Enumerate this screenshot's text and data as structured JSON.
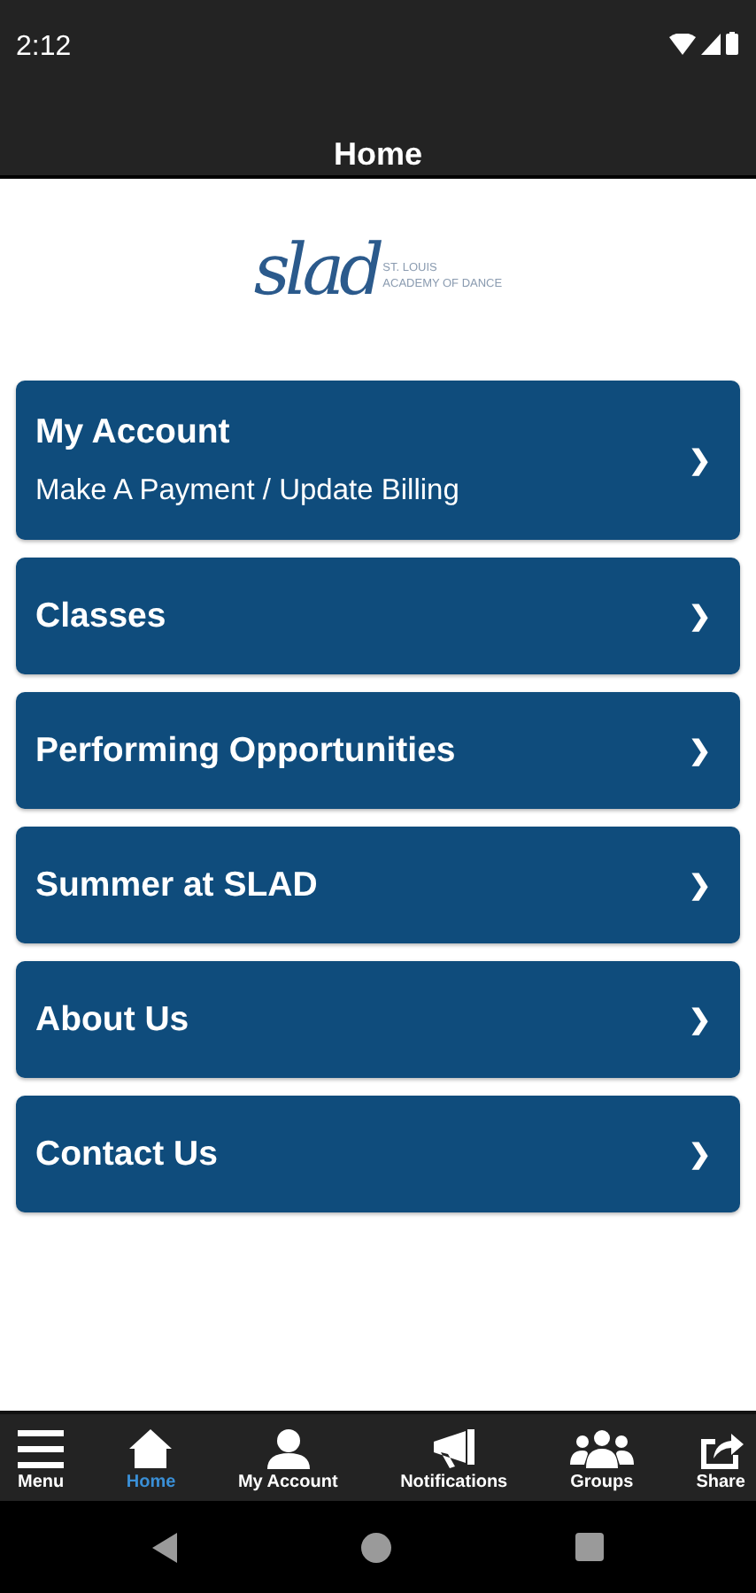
{
  "status_bar": {
    "time": "2:12"
  },
  "header": {
    "title": "Home"
  },
  "logo": {
    "script": "slad",
    "line_1": "ST. LOUIS",
    "line_2": "ACADEMY OF DANCE"
  },
  "menu_items": [
    {
      "title": "My Account",
      "subtitle": "Make A Payment / Update Billing",
      "chevron": "❯"
    },
    {
      "title": "Classes",
      "chevron": "❯"
    },
    {
      "title": "Performing Opportunities",
      "chevron": "❯"
    },
    {
      "title": "Summer at SLAD",
      "chevron": "❯"
    },
    {
      "title": "About Us",
      "chevron": "❯"
    },
    {
      "title": "Contact Us",
      "chevron": "❯"
    }
  ],
  "bottom_nav": [
    {
      "kind": "menu",
      "label": "Menu",
      "selected": false
    },
    {
      "kind": "home",
      "label": "Home",
      "selected": true
    },
    {
      "kind": "account",
      "label": "My Account",
      "selected": false
    },
    {
      "kind": "notifications",
      "label": "Notifications",
      "selected": false
    },
    {
      "kind": "groups",
      "label": "Groups",
      "selected": false
    },
    {
      "kind": "share",
      "label": "Share",
      "selected": false
    }
  ]
}
